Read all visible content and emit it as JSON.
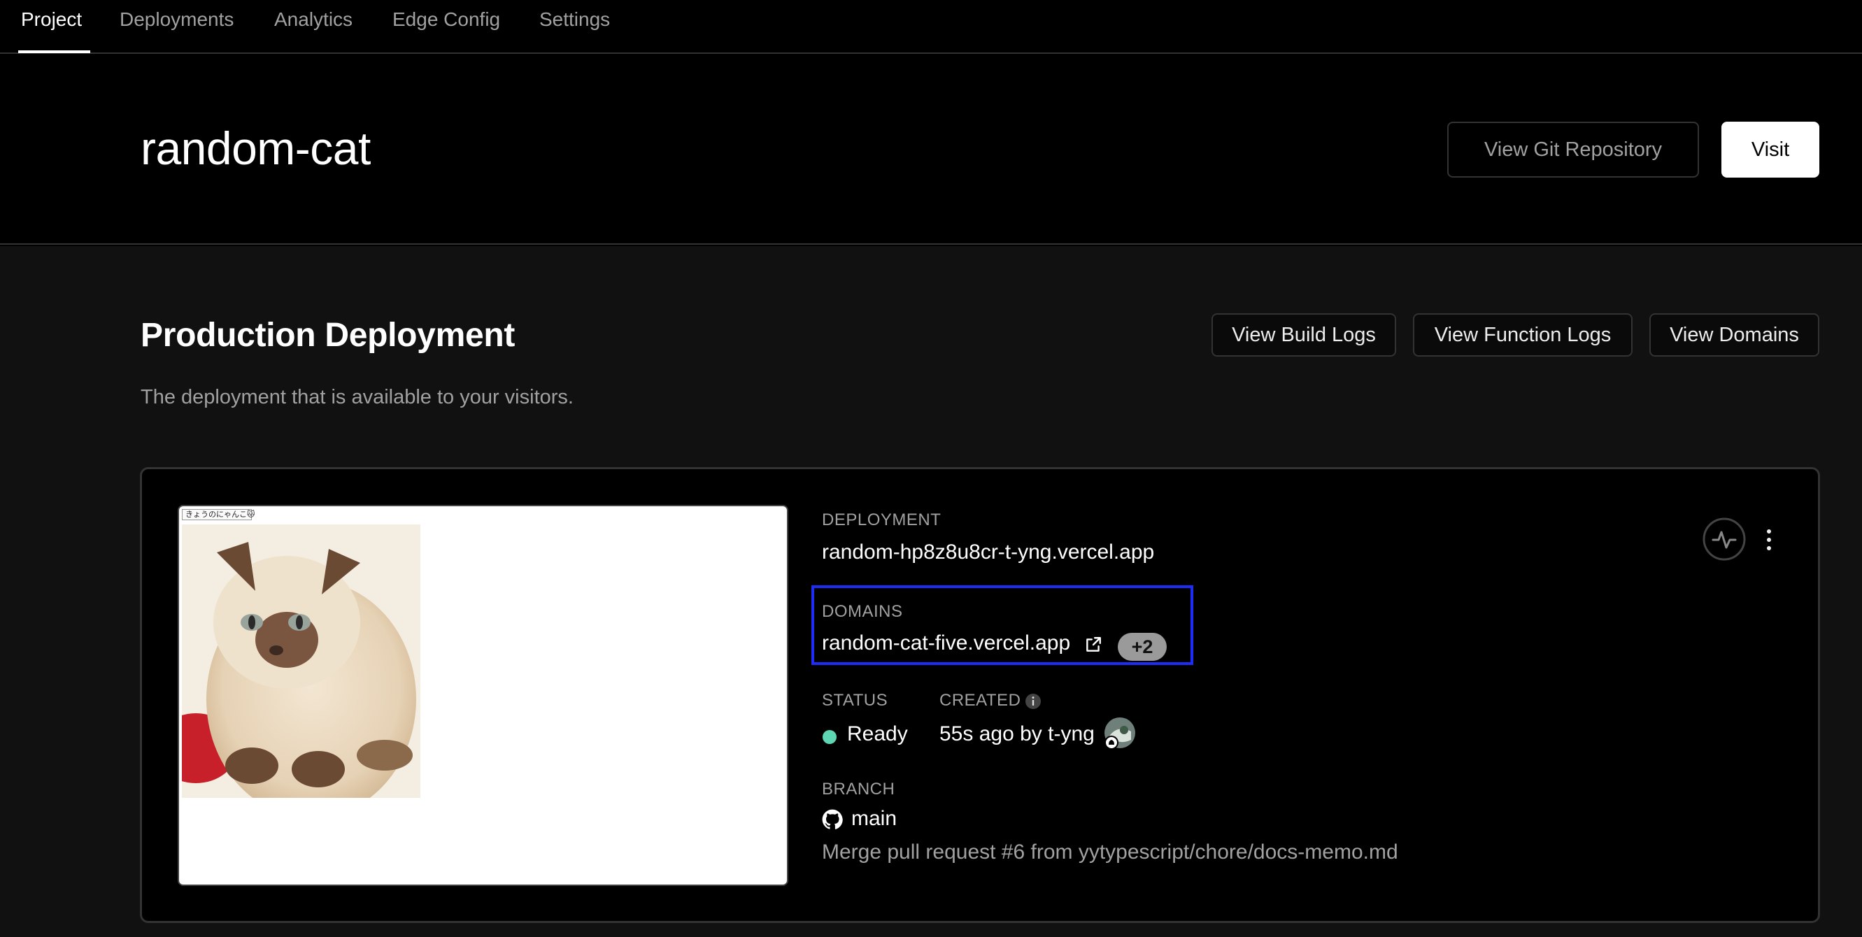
{
  "nav": {
    "tabs": [
      "Project",
      "Deployments",
      "Analytics",
      "Edge Config",
      "Settings"
    ],
    "active_tab": "Project"
  },
  "header": {
    "project_name": "random-cat",
    "view_git_label": "View Git Repository",
    "visit_label": "Visit"
  },
  "production": {
    "title": "Production Deployment",
    "subtitle": "The deployment that is available to your visitors.",
    "buttons": {
      "build_logs": "View Build Logs",
      "function_logs": "View Function Logs",
      "domains": "View Domains"
    }
  },
  "deployment": {
    "preview_tag": "きょうのにゃんこ🐱",
    "deployment_label": "DEPLOYMENT",
    "deployment_url": "random-hp8z8u8cr-t-yng.vercel.app",
    "domains_label": "DOMAINS",
    "domain": "random-cat-five.vercel.app",
    "extra_domains": "+2",
    "status_label": "STATUS",
    "status_value": "Ready",
    "status_color": "#5fd6b2",
    "created_label": "CREATED",
    "created_value": "55s ago by t-yng",
    "branch_label": "BRANCH",
    "branch_value": "main",
    "commit_message": "Merge pull request #6 from yytypescript/chore/docs-memo.md"
  },
  "colors": {
    "highlight": "#1d2df5",
    "background": "#000000",
    "section_bg": "#111111"
  },
  "icons": [
    "external-link-icon",
    "info-icon",
    "github-icon",
    "activity-icon",
    "more-vertical-icon",
    "avatar"
  ]
}
